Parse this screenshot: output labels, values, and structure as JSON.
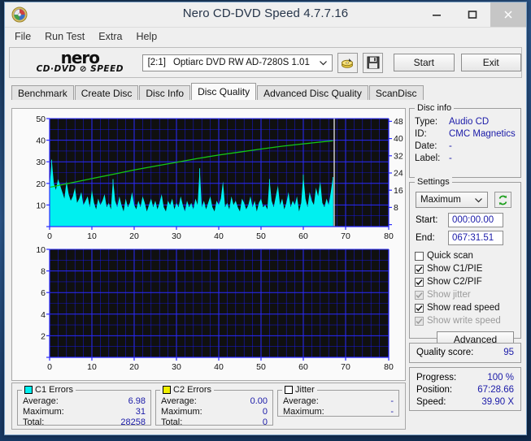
{
  "window": {
    "title": "Nero CD-DVD Speed 4.7.7.16",
    "app_icon": "nero-disc-icon",
    "buttons": {
      "minimize": "minimize-icon",
      "maximize": "maximize-icon",
      "close": "close-icon"
    }
  },
  "menu": {
    "items": [
      "File",
      "Run Test",
      "Extra",
      "Help"
    ]
  },
  "toolbar": {
    "logo_line1": "nero",
    "logo_line2": "CD·DVD ⊘ SPEED",
    "drive_id": "[2:1]",
    "drive_name": "Optiarc DVD RW AD-7280S 1.01",
    "eject_icon": "disc-eject-icon",
    "save_icon": "save-floppy-icon",
    "start_label": "Start",
    "exit_label": "Exit"
  },
  "tabs": {
    "items": [
      "Benchmark",
      "Create Disc",
      "Disc Info",
      "Disc Quality",
      "Advanced Disc Quality",
      "ScanDisc"
    ],
    "active": "Disc Quality"
  },
  "disc_info": {
    "legend": "Disc info",
    "rows": [
      {
        "key": "Type:",
        "value": "Audio CD"
      },
      {
        "key": "ID:",
        "value": "CMC Magnetics"
      },
      {
        "key": "Date:",
        "value": "-"
      },
      {
        "key": "Label:",
        "value": "-"
      }
    ]
  },
  "settings": {
    "legend": "Settings",
    "speed_value": "Maximum",
    "refresh_icon": "refresh-green-icon",
    "start_label": "Start:",
    "start_value": "000:00.00",
    "end_label": "End:",
    "end_value": "067:31.51",
    "checkboxes": [
      {
        "label": "Quick scan",
        "checked": false,
        "enabled": true
      },
      {
        "label": "Show C1/PIE",
        "checked": true,
        "enabled": true
      },
      {
        "label": "Show C2/PIF",
        "checked": true,
        "enabled": true
      },
      {
        "label": "Show jitter",
        "checked": true,
        "enabled": false
      },
      {
        "label": "Show read speed",
        "checked": true,
        "enabled": true
      },
      {
        "label": "Show write speed",
        "checked": true,
        "enabled": false
      }
    ],
    "advanced_label": "Advanced"
  },
  "quality": {
    "label": "Quality score:",
    "value": "95"
  },
  "progress": {
    "rows": [
      {
        "key": "Progress:",
        "value": "100 %"
      },
      {
        "key": "Position:",
        "value": "67:28.66"
      },
      {
        "key": "Speed:",
        "value": "39.90 X"
      }
    ]
  },
  "stats": {
    "c1": {
      "legend": "C1 Errors",
      "color": "#00f0f0",
      "rows": [
        {
          "key": "Average:",
          "value": "6.98"
        },
        {
          "key": "Maximum:",
          "value": "31"
        },
        {
          "key": "Total:",
          "value": "28258"
        }
      ]
    },
    "c2": {
      "legend": "C2 Errors",
      "color": "#f0f000",
      "rows": [
        {
          "key": "Average:",
          "value": "0.00"
        },
        {
          "key": "Maximum:",
          "value": "0"
        },
        {
          "key": "Total:",
          "value": "0"
        }
      ]
    },
    "jitter": {
      "legend": "Jitter",
      "color": "#ffffff",
      "rows": [
        {
          "key": "Average:",
          "value": "-"
        },
        {
          "key": "Maximum:",
          "value": "-"
        }
      ]
    }
  },
  "chart_data": [
    {
      "type": "area",
      "name": "c1-errors-chart",
      "title": "",
      "xlabel": "",
      "ylabel": "",
      "xlim": [
        0,
        80
      ],
      "ylim": [
        0,
        50
      ],
      "y2lim": [
        0,
        50
      ],
      "xticks": [
        0,
        10,
        20,
        30,
        40,
        50,
        60,
        70,
        80
      ],
      "yticks": [
        10,
        20,
        30,
        40,
        50
      ],
      "y2ticks": [
        8,
        16,
        24,
        32,
        40,
        48
      ],
      "grid": true,
      "background": "#101010",
      "grid_color": "#1a1aff",
      "data_end_x": 67.0,
      "series": [
        {
          "name": "C1 Errors",
          "color": "#00f0f0",
          "kind": "area",
          "x": [
            0,
            0.5,
            1,
            1.5,
            2,
            2.5,
            3,
            3.5,
            4,
            4.5,
            5,
            5.5,
            6,
            6.5,
            7,
            7.5,
            8,
            8.5,
            9,
            9.5,
            10,
            10.5,
            11,
            11.5,
            12,
            12.5,
            13,
            13.5,
            14,
            14.5,
            15,
            15.5,
            16,
            16.5,
            17,
            17.5,
            18,
            18.5,
            19,
            19.5,
            20,
            20.5,
            21,
            21.5,
            22,
            22.5,
            23,
            23.5,
            24,
            24.5,
            25,
            25.5,
            26,
            26.5,
            27,
            27.5,
            28,
            28.5,
            29,
            29.5,
            30,
            30.5,
            31,
            31.5,
            32,
            32.5,
            33,
            33.5,
            34,
            34.5,
            35,
            35.5,
            36,
            36.5,
            37,
            37.5,
            38,
            38.5,
            39,
            39.5,
            40,
            40.5,
            41,
            41.5,
            42,
            42.5,
            43,
            43.5,
            44,
            44.5,
            45,
            45.5,
            46,
            46.5,
            47,
            47.5,
            48,
            48.5,
            49,
            49.5,
            50,
            50.5,
            51,
            51.5,
            52,
            52.5,
            53,
            53.5,
            54,
            54.5,
            55,
            55.5,
            56,
            56.5,
            57,
            57.5,
            58,
            58.5,
            59,
            59.5,
            60,
            60.5,
            61,
            61.5,
            62,
            62.5,
            63,
            63.5,
            64,
            64.5,
            65,
            65.5,
            66,
            66.5,
            67
          ],
          "y": [
            18,
            31,
            20,
            17,
            22,
            19,
            16,
            13,
            21,
            15,
            12,
            14,
            18,
            11,
            13,
            16,
            10,
            12,
            14,
            9,
            17,
            11,
            8,
            13,
            10,
            12,
            15,
            9,
            11,
            8,
            22,
            12,
            9,
            14,
            10,
            7,
            13,
            9,
            11,
            16,
            10,
            8,
            12,
            9,
            14,
            11,
            7,
            10,
            13,
            9,
            12,
            8,
            11,
            15,
            9,
            7,
            12,
            10,
            13,
            8,
            11,
            9,
            14,
            10,
            7,
            12,
            9,
            11,
            8,
            13,
            10,
            27,
            9,
            12,
            8,
            11,
            14,
            9,
            7,
            12,
            10,
            13,
            21,
            9,
            11,
            8,
            14,
            10,
            12,
            9,
            7,
            13,
            11,
            8,
            10,
            14,
            9,
            12,
            7,
            11,
            13,
            9,
            10,
            8,
            22,
            12,
            9,
            14,
            19,
            10,
            13,
            8,
            11,
            16,
            9,
            12,
            10,
            14,
            7,
            11,
            24,
            13,
            9,
            16,
            12,
            10,
            18,
            14,
            21,
            11,
            9,
            13,
            10,
            16,
            23
          ],
          "avg": 6.98,
          "max": 31,
          "total": 28258
        },
        {
          "name": "Read speed",
          "color": "#00c000",
          "kind": "line",
          "axis": "right",
          "x": [
            0,
            5,
            10,
            15,
            20,
            25,
            30,
            35,
            40,
            45,
            50,
            55,
            60,
            65,
            67
          ],
          "y": [
            18.5,
            20.5,
            22.5,
            24.5,
            26.5,
            28.3,
            30.0,
            31.8,
            33.4,
            34.8,
            36.2,
            37.5,
            38.6,
            39.6,
            40.0
          ]
        }
      ]
    },
    {
      "type": "line",
      "name": "c2-errors-chart",
      "title": "",
      "xlabel": "",
      "ylabel": "",
      "xlim": [
        0,
        80
      ],
      "ylim": [
        0,
        10
      ],
      "xticks": [
        0,
        10,
        20,
        30,
        40,
        50,
        60,
        70,
        80
      ],
      "yticks": [
        2,
        4,
        6,
        8,
        10
      ],
      "grid": true,
      "background": "#101010",
      "grid_color": "#1a1aff",
      "series": [
        {
          "name": "C2 Errors",
          "color": "#f0f000",
          "kind": "area",
          "x": [],
          "y": []
        }
      ]
    }
  ]
}
